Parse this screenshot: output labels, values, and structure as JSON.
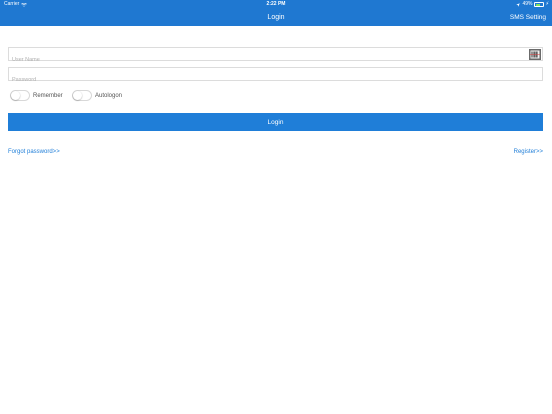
{
  "status_bar": {
    "carrier": "Carrier",
    "time": "2:22 PM",
    "battery_percent": "49%",
    "battery_level": 0.49,
    "wifi_icon": "wifi-icon",
    "location_icon": "location-arrow-icon",
    "charge_icon": "charging-bolt-icon"
  },
  "nav_bar": {
    "title": "Login",
    "right_action": "SMS Setting",
    "color": "#1f78d1"
  },
  "form": {
    "username": {
      "placeholder": "User Name",
      "value": ""
    },
    "password": {
      "placeholder": "Password",
      "value": ""
    },
    "scan_icon": "barcode-scan-icon",
    "remember": {
      "label": "Remember",
      "on": false
    },
    "autologon": {
      "label": "Autologon",
      "on": false
    },
    "login_label": "Login"
  },
  "links": {
    "forgot": "Forgot password>>",
    "register": "Register>>"
  },
  "colors": {
    "accent": "#1f7ed8",
    "battery": "#7ee35f"
  }
}
